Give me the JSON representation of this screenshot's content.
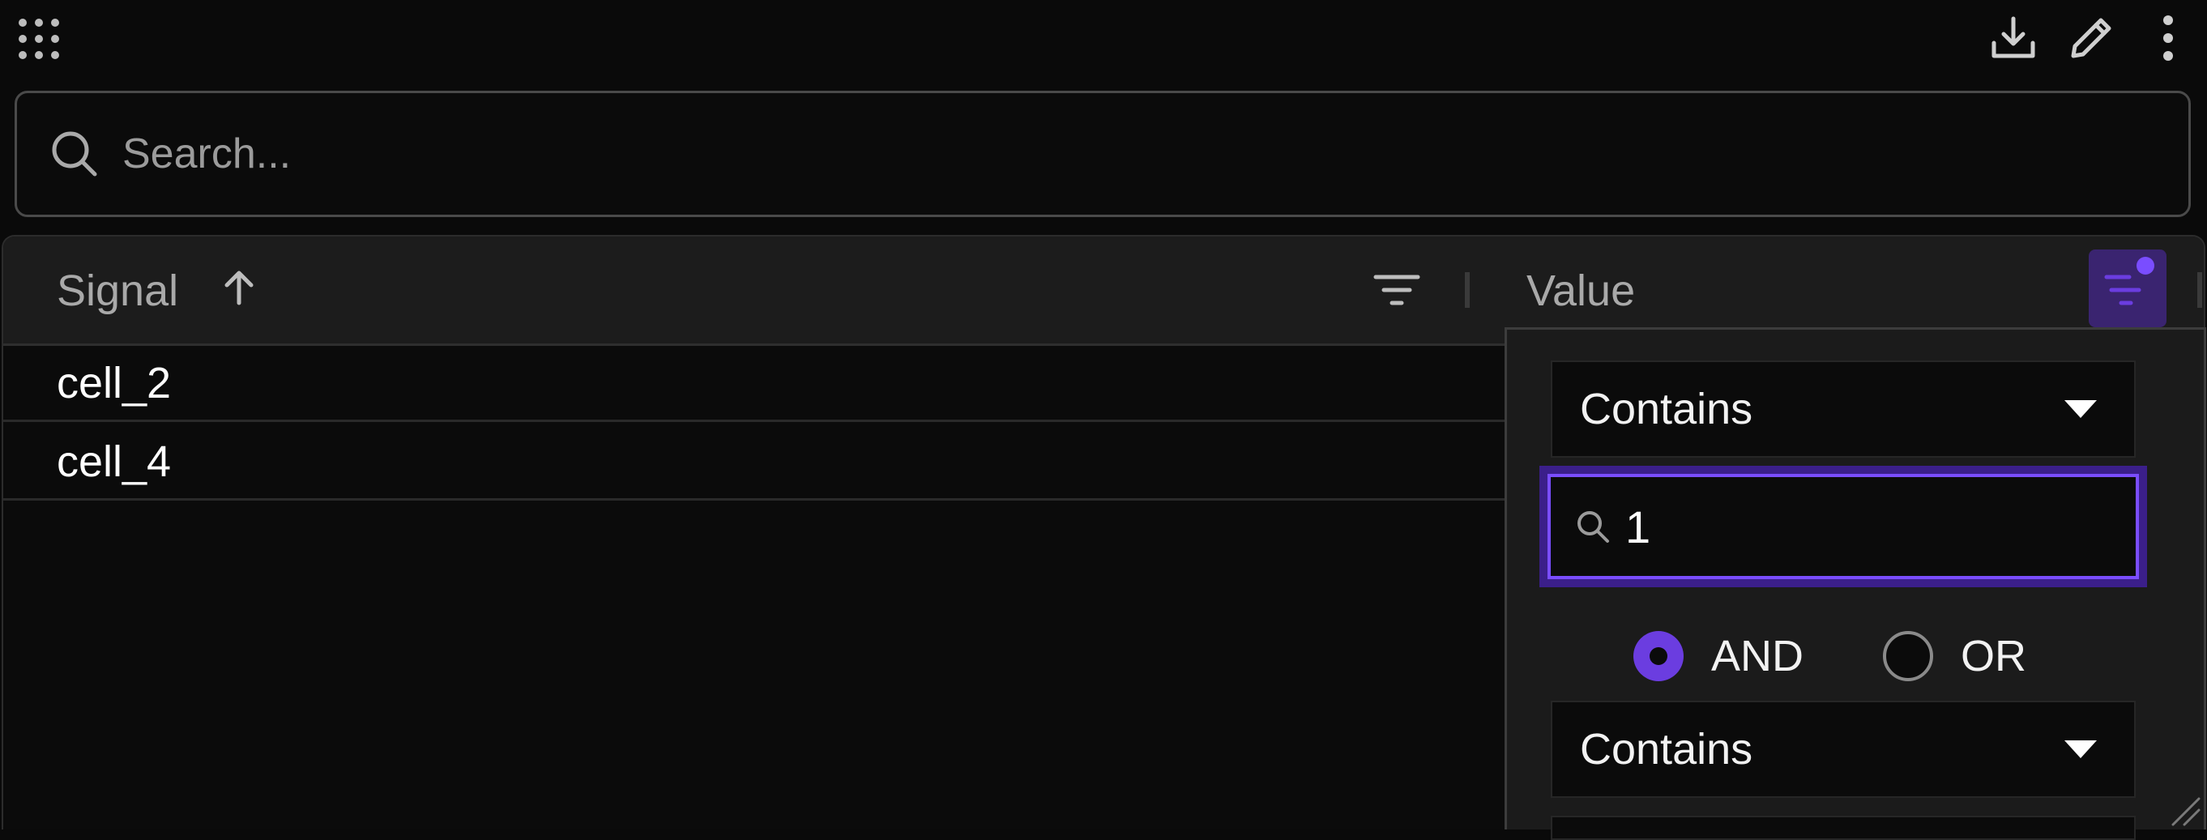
{
  "toolbar": {
    "apps_icon": "grid-dots-icon",
    "download_icon": "download-icon",
    "edit_icon": "pencil-icon",
    "more_icon": "more-vertical-icon"
  },
  "search": {
    "placeholder": "Search..."
  },
  "table": {
    "columns": [
      {
        "label": "Signal",
        "sort": "ascending"
      },
      {
        "label": "Value",
        "filter_active": true
      }
    ],
    "rows": [
      {
        "signal": "cell_2"
      },
      {
        "signal": "cell_4"
      }
    ]
  },
  "filter_popup": {
    "condition_1": "Contains",
    "value_1": "1",
    "operator_and": "AND",
    "operator_or": "OR",
    "selected_operator": "AND",
    "condition_2": "Contains"
  },
  "colors": {
    "accent": "#6b3de0",
    "accent_border": "#7a4dff",
    "background": "#0a0a0a",
    "header": "#1c1c1c"
  }
}
